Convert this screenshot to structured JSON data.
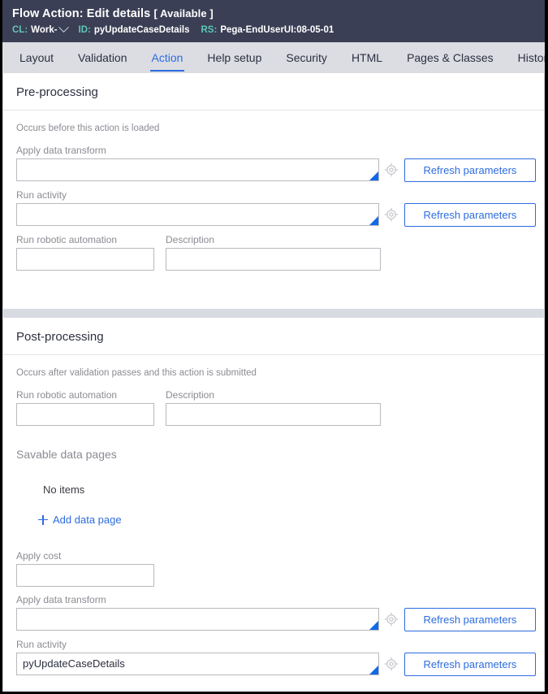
{
  "header": {
    "title_prefix": "Flow Action:",
    "title_name": "Edit details",
    "availability": "[ Available ]",
    "class_label": "CL:",
    "class_value": "Work-",
    "id_label": "ID:",
    "id_value": "pyUpdateCaseDetails",
    "ruleset_label": "RS:",
    "ruleset_value": "Pega-EndUserUI:08-05-01",
    "accent_label_color": "#5fc7b8",
    "background_color": "#3b3f55"
  },
  "tabs": [
    {
      "label": "Layout",
      "active": false
    },
    {
      "label": "Validation",
      "active": false
    },
    {
      "label": "Action",
      "active": true
    },
    {
      "label": "Help setup",
      "active": false
    },
    {
      "label": "Security",
      "active": false
    },
    {
      "label": "HTML",
      "active": false
    },
    {
      "label": "Pages & Classes",
      "active": false
    },
    {
      "label": "History",
      "active": false
    }
  ],
  "accent_color": "#2d6cdf",
  "preprocessing": {
    "title": "Pre-processing",
    "description": "Occurs before this action is loaded",
    "apply_data_transform": {
      "label": "Apply data transform",
      "value": "",
      "button": "Refresh parameters"
    },
    "run_activity": {
      "label": "Run activity",
      "value": "",
      "button": "Refresh parameters"
    },
    "run_robotic_automation": {
      "label": "Run robotic automation",
      "value": ""
    },
    "description_field": {
      "label": "Description",
      "value": ""
    }
  },
  "postprocessing": {
    "title": "Post-processing",
    "description": "Occurs after validation passes and this action is submitted",
    "run_robotic_automation": {
      "label": "Run robotic automation",
      "value": ""
    },
    "description_field": {
      "label": "Description",
      "value": ""
    },
    "savable_data_pages": {
      "title": "Savable data pages",
      "empty_text": "No items",
      "add_label": "Add data page"
    },
    "apply_cost": {
      "label": "Apply cost",
      "value": ""
    },
    "apply_data_transform": {
      "label": "Apply data transform",
      "value": "",
      "button": "Refresh parameters"
    },
    "run_activity": {
      "label": "Run activity",
      "value": "pyUpdateCaseDetails",
      "button": "Refresh parameters"
    }
  }
}
